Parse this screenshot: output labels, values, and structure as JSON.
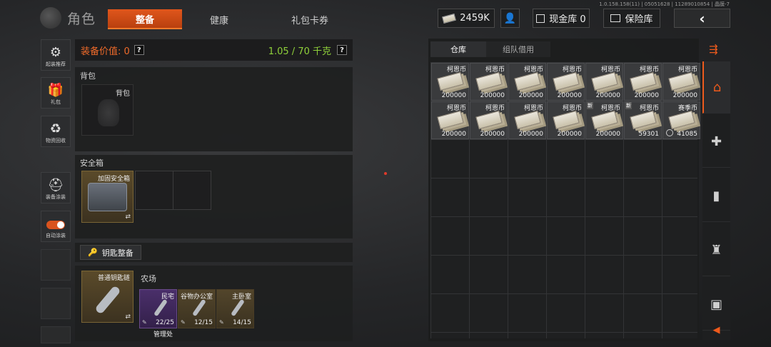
{
  "version": "1.0.158.158(11) | 05051628 | 11289010854 | 晶膜-7",
  "header": {
    "title": "角色",
    "tabs": [
      "整备",
      "健康",
      "礼包卡券"
    ],
    "money": "2459K",
    "cash_label": "现金库 0",
    "safe_label": "保险库"
  },
  "left_rail": [
    {
      "label": "起装推荐",
      "icon": "backpack-gear-icon"
    },
    {
      "label": "礼包",
      "icon": "gift-icon"
    },
    {
      "label": "物资回收",
      "icon": "recycle-icon"
    },
    {
      "label": "装备涂装",
      "icon": "helmet-icon"
    },
    {
      "label": "自动涂装",
      "icon": "toggle-icon"
    }
  ],
  "loadout": {
    "value_label": "装备价值: 0",
    "weight": "1.05 / 70 千克",
    "backpack_section": "背包",
    "backpack_slot": "背包",
    "case_section": "安全箱",
    "case_item": "加固安全箱",
    "key_button": "钥匙整备",
    "keychain_item": "普通钥匙链",
    "farm_label": "农场",
    "keys": [
      {
        "name": "民宅",
        "count": "22/25",
        "rarity": "purple"
      },
      {
        "name": "谷物办公室",
        "count": "12/15",
        "rarity": "gold"
      },
      {
        "name": "主卧室",
        "count": "14/15",
        "rarity": "gold"
      }
    ],
    "fifth_key": "管理处"
  },
  "warehouse": {
    "tabs": [
      "仓库",
      "组队借用"
    ],
    "items": [
      {
        "name": "柯恩币",
        "count": "200000",
        "new": false,
        "ring": false
      },
      {
        "name": "柯恩币",
        "count": "200000",
        "new": false,
        "ring": false
      },
      {
        "name": "柯恩币",
        "count": "200000",
        "new": false,
        "ring": false
      },
      {
        "name": "柯恩币",
        "count": "200000",
        "new": false,
        "ring": false
      },
      {
        "name": "柯恩币",
        "count": "200000",
        "new": false,
        "ring": false
      },
      {
        "name": "柯恩币",
        "count": "200000",
        "new": false,
        "ring": false
      },
      {
        "name": "柯恩币",
        "count": "200000",
        "new": false,
        "ring": false
      },
      {
        "name": "柯恩币",
        "count": "200000",
        "new": false,
        "ring": false
      },
      {
        "name": "柯恩币",
        "count": "200000",
        "new": false,
        "ring": false
      },
      {
        "name": "柯恩币",
        "count": "200000",
        "new": false,
        "ring": false
      },
      {
        "name": "柯恩币",
        "count": "200000",
        "new": false,
        "ring": false
      },
      {
        "name": "柯恩币",
        "count": "200000",
        "new": true,
        "ring": false
      },
      {
        "name": "柯恩币",
        "count": "59301",
        "new": true,
        "ring": false
      },
      {
        "name": "赛季币",
        "count": "41085",
        "new": false,
        "ring": true
      }
    ],
    "new_badge": "新"
  },
  "right_rail": [
    "home-icon",
    "medkit-icon",
    "ammo-icon",
    "armor-icon",
    "box-icon"
  ]
}
